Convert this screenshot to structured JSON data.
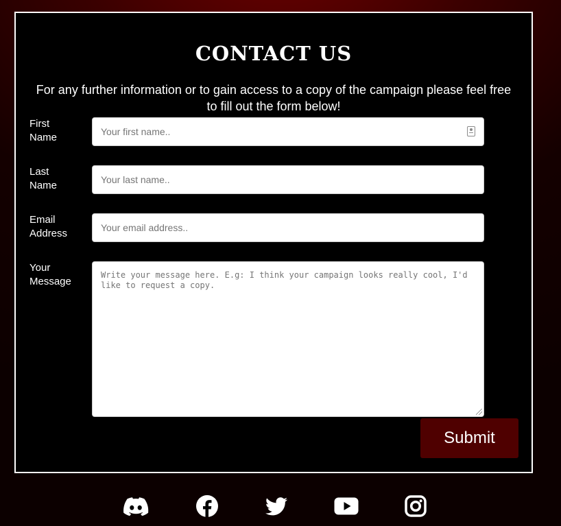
{
  "contact": {
    "title": "CONTACT US",
    "intro": "For any further information or to gain access to a copy of the campaign please feel free to fill out the form below!",
    "fields": [
      {
        "label_line1": "First",
        "label_line2": "Name",
        "placeholder": "Your first name.."
      },
      {
        "label_line1": "Last",
        "label_line2": "Name",
        "placeholder": "Your last name.."
      },
      {
        "label_line1": "Email",
        "label_line2": "Address",
        "placeholder": "Your email address.."
      },
      {
        "label_line1": "Your",
        "label_line2": "Message",
        "placeholder": "Write your message here. E.g: I think your campaign looks really cool, I'd like to request a copy."
      }
    ],
    "submit_label": "Submit"
  },
  "social": {
    "icons": [
      "discord-icon",
      "facebook-icon",
      "twitter-icon",
      "youtube-icon",
      "instagram-icon"
    ]
  },
  "colors": {
    "background": "#0c0000",
    "accent_red": "#6e0000",
    "submit_bg": "#4f0000",
    "panel": "#000000",
    "border": "#ffffff"
  }
}
